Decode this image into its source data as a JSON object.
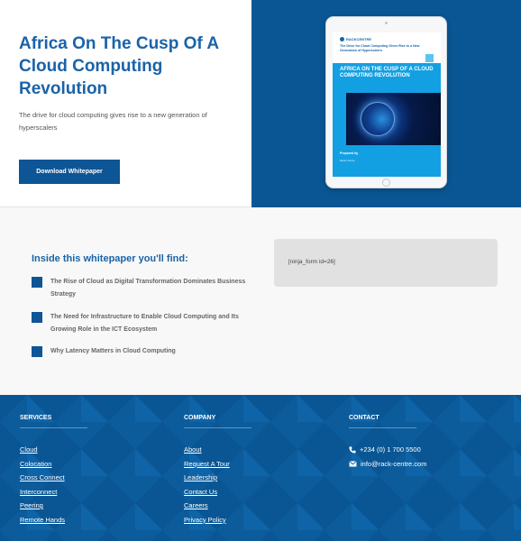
{
  "hero": {
    "title": "Africa On The Cusp Of A Cloud Computing Revolution",
    "subtitle": "The drive for cloud computing gives rise to a new generation of hyperscalers",
    "button_label": "Download Whitepaper"
  },
  "cover": {
    "logo": "RACKCENTRE",
    "tagline": "The Drive for Cloud Computing Gives Rise to a New Generation of Hyperscalers",
    "title": "AFRICA ON THE CUSP OF A CLOUD COMPUTING REVOLUTION",
    "prepared": "Prepared by",
    "prepared_by": "Rack Centre"
  },
  "inside": {
    "title": "Inside this whitepaper you'll find:",
    "items": [
      "The Rise of Cloud as Digital Transformation Dominates Business Strategy",
      "The Need for Infrastructure to Enable Cloud Computing and Its Growing Role in the ICT Ecosystem",
      "Why Latency Matters in Cloud Computing"
    ],
    "form_shortcode": "[ninja_form id=26]"
  },
  "footer": {
    "services": {
      "heading": "SERVICES",
      "links": [
        "Cloud",
        "Colocation",
        "Cross Connect",
        "Interconnect",
        "Peering",
        "Remote Hands"
      ]
    },
    "company": {
      "heading": "COMPANY",
      "links": [
        "About",
        "Request A Tour",
        "Leadership",
        "Contact Us",
        "Careers",
        "Privacy Policy"
      ]
    },
    "contact": {
      "heading": "CONTACT",
      "phone": "+234 (0) 1 700 5500",
      "email": "info@rack-centre.com"
    }
  },
  "colors": {
    "brand_blue": "#1a63a8",
    "dark_blue": "#0a5694",
    "accent_cyan": "#13a0e2"
  }
}
